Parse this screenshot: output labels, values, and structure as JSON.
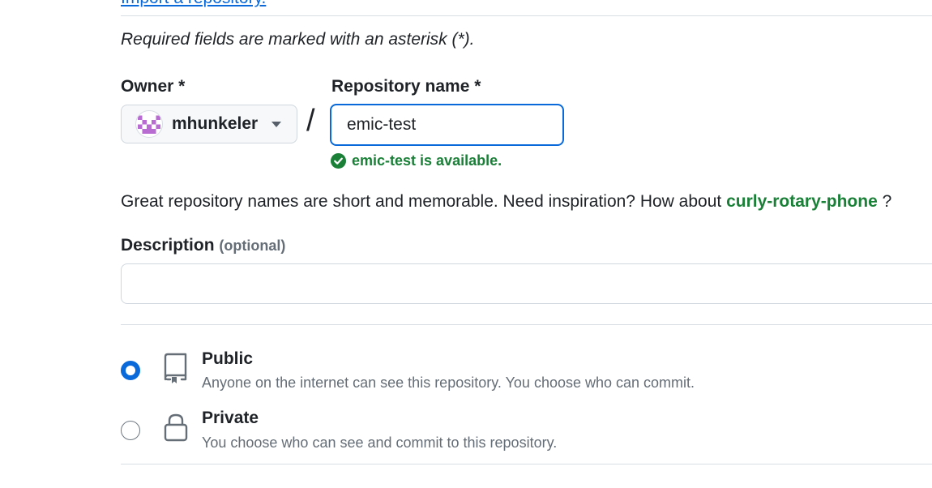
{
  "top_link": "Import a repository.",
  "required_note": "Required fields are marked with an asterisk (*).",
  "owner": {
    "label": "Owner *",
    "name": "mhunkeler",
    "avatar_icon": "identicon"
  },
  "separator": "/",
  "repo": {
    "label": "Repository name *",
    "value": "emic-test",
    "availability": "emic-test is available."
  },
  "suggestion": {
    "prefix": "Great repository names are short and memorable. Need inspiration? How about",
    "name": "curly-rotary-phone",
    "suffix": "?"
  },
  "description": {
    "label": "Description",
    "optional": "(optional)",
    "value": "",
    "placeholder": ""
  },
  "visibility": {
    "selected": "public",
    "options": [
      {
        "title": "Public",
        "desc": "Anyone on the internet can see this repository. You choose who can commit.",
        "icon": "repo-icon"
      },
      {
        "title": "Private",
        "desc": "You choose who can see and commit to this repository.",
        "icon": "lock-icon"
      }
    ]
  },
  "colors": {
    "accent": "#0969da",
    "success": "#1a7f37",
    "muted": "#656d76",
    "border": "#d0d7de"
  }
}
